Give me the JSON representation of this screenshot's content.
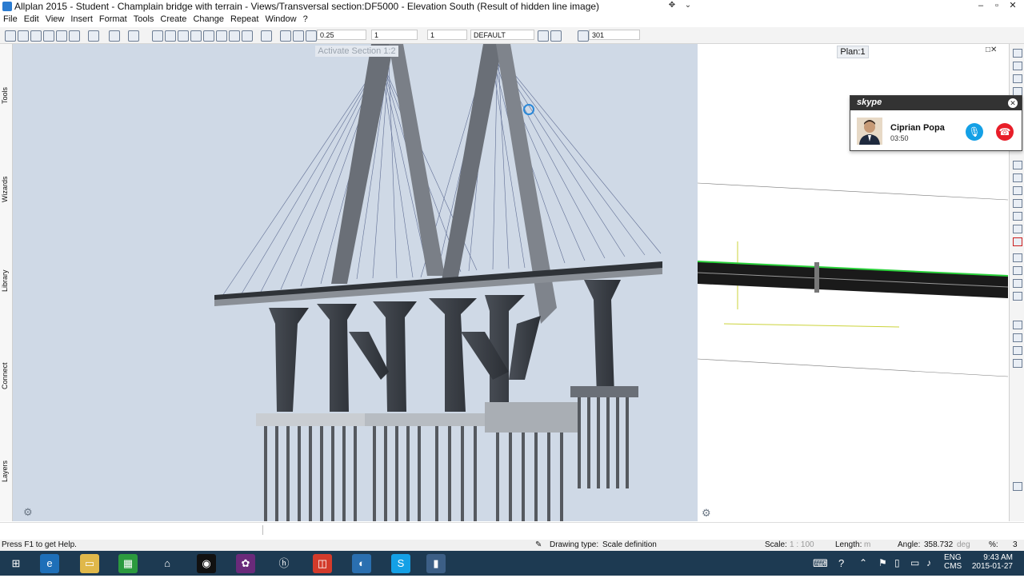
{
  "window": {
    "title": "Allplan 2015 - Student - Champlain bridge with terrain - Views/Transversal section:DF5000 - Elevation South (Result of hidden line image)"
  },
  "menu": [
    "File",
    "Edit",
    "View",
    "Insert",
    "Format",
    "Tools",
    "Create",
    "Change",
    "Repeat",
    "Window",
    "?"
  ],
  "toolbar": {
    "pen_value": "0.25",
    "line_value": "1",
    "color_value": "1",
    "layer_value": "DEFAULT",
    "pattern_value": "301"
  },
  "sidebar": {
    "tabs": [
      "Tools",
      "Wizards",
      "Library",
      "Connect",
      "Layers"
    ]
  },
  "viewport": {
    "label": "Activate Section 1:2"
  },
  "plan": {
    "label": "Plan:1"
  },
  "skype": {
    "logo": "skype",
    "contact_name": "Ciprian Popa",
    "call_duration": "03:50"
  },
  "statusbar": {
    "help": "Press F1 to get Help.",
    "drawing_type_label": "Drawing type:",
    "drawing_type_value": "Scale definition",
    "scale_label": "Scale:",
    "scale_value": "1 : 100",
    "length_label": "Length:",
    "length_unit": "m",
    "angle_label": "Angle:",
    "angle_value": "358.732",
    "angle_unit": "deg",
    "percent_label": "%:",
    "percent_value": "3"
  },
  "taskbar": {
    "language_top": "ENG",
    "language_bottom": "CMS",
    "time": "9:43 AM",
    "date": "2015-01-27"
  },
  "colors": {
    "viewport_bg": "#cfd9e6",
    "taskbar_bg": "#1d3a52",
    "skype_blue": "#14a0e6",
    "skype_red": "#e81e29"
  }
}
